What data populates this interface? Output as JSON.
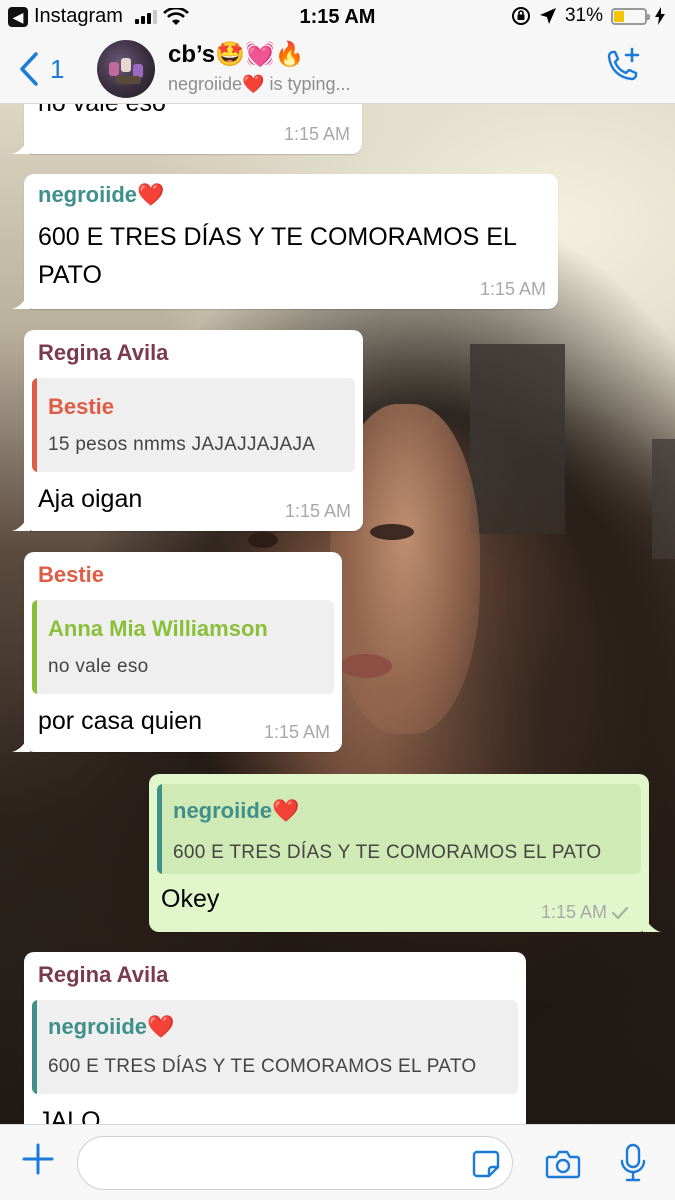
{
  "status_bar": {
    "back_app": "Instagram",
    "time": "1:15 AM",
    "battery": "31%",
    "battery_level": 0.31
  },
  "header": {
    "back_count": "1",
    "title": "cb’s🤩💓🔥",
    "subtitle": "negroiide❤️ is typing..."
  },
  "messages": [
    {
      "text": "no vale eso",
      "time": "1:15 AM"
    },
    {
      "sender": "negroiide❤️",
      "sender_color": "#3f8f8a",
      "text_line1": "600 E TRES DÍAS Y TE COMORAMOS EL",
      "text_line2": "PATO",
      "time": "1:15 AM"
    },
    {
      "sender": "Regina Avila",
      "sender_color": "#7a3b50",
      "quote_name": "Bestie",
      "quote_color": "#e05c45",
      "quote_text": "15 pesos nmms JAJAJJAJAJA",
      "text": "Aja oigan",
      "time": "1:15 AM"
    },
    {
      "sender": "Bestie",
      "sender_color": "#e05c45",
      "quote_name": "Anna Mia Williamson",
      "quote_color": "#8bbf3a",
      "quote_text": "no vale eso",
      "text": "por casa quien",
      "time": "1:15 AM"
    },
    {
      "quote_name": "negroiide❤️",
      "quote_color": "#3f8f8a",
      "quote_text": "600 E TRES DÍAS Y TE COMORAMOS EL PATO",
      "text": "Okey",
      "time": "1:15 AM"
    },
    {
      "sender": "Regina Avila",
      "sender_color": "#7a3b50",
      "quote_name": "negroiide❤️",
      "quote_color": "#3f8f8a",
      "quote_text": "600 E TRES DÍAS Y TE COMORAMOS EL PATO",
      "text": "JALO"
    }
  ],
  "icons": {
    "back": "chevron-left-icon",
    "call": "phone-add-icon",
    "attach": "plus-icon",
    "sticker": "sticker-icon",
    "camera": "camera-icon",
    "mic": "microphone-icon"
  },
  "colors": {
    "accent": "#1a7bd8",
    "outgoing_bubble": "#e1f7cb",
    "incoming_bubble": "#ffffff"
  }
}
